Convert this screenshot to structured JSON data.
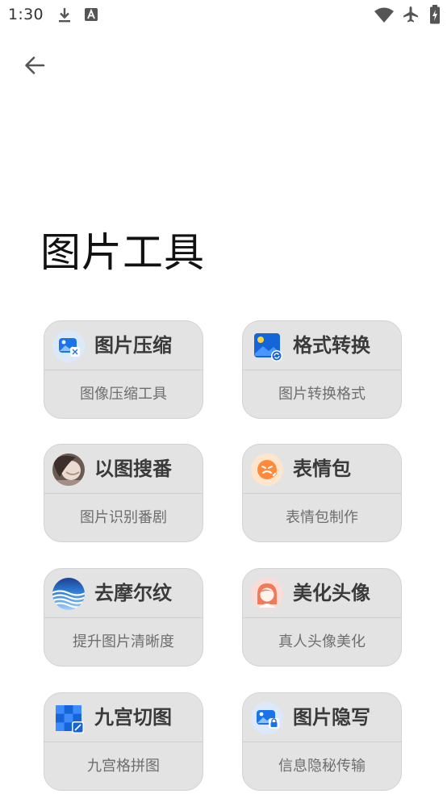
{
  "status_bar": {
    "time": "1:30",
    "icons": [
      "download-icon",
      "text-a-icon",
      "wifi-icon",
      "airplane-mode-icon",
      "battery-charging-icon"
    ]
  },
  "header": {
    "back_icon": "arrow-left-icon"
  },
  "page": {
    "title": "图片工具"
  },
  "colors": {
    "card_bg": "#e3e3e3",
    "card_border": "#d2d2d2",
    "title_text": "#3a3a3a",
    "subtitle_text": "#6e6e6e",
    "accent_blue": "#1a73e8"
  },
  "tools": [
    {
      "id": "compress",
      "title": "图片压缩",
      "subtitle": "图像压缩工具",
      "icon": "image-compress-icon"
    },
    {
      "id": "convert",
      "title": "格式转换",
      "subtitle": "图片转换格式",
      "icon": "format-convert-icon"
    },
    {
      "id": "search",
      "title": "以图搜番",
      "subtitle": "图片识别番剧",
      "icon": "anime-search-icon"
    },
    {
      "id": "emoji",
      "title": "表情包",
      "subtitle": "表情包制作",
      "icon": "emoji-face-icon"
    },
    {
      "id": "moire",
      "title": "去摩尔纹",
      "subtitle": "提升图片清晰度",
      "icon": "moire-wave-icon"
    },
    {
      "id": "avatar",
      "title": "美化头像",
      "subtitle": "真人头像美化",
      "icon": "avatar-beautify-icon"
    },
    {
      "id": "grid",
      "title": "九宫切图",
      "subtitle": "九宫格拼图",
      "icon": "nine-grid-icon"
    },
    {
      "id": "hide",
      "title": "图片隐写",
      "subtitle": "信息隐秘传输",
      "icon": "image-lock-icon"
    }
  ]
}
